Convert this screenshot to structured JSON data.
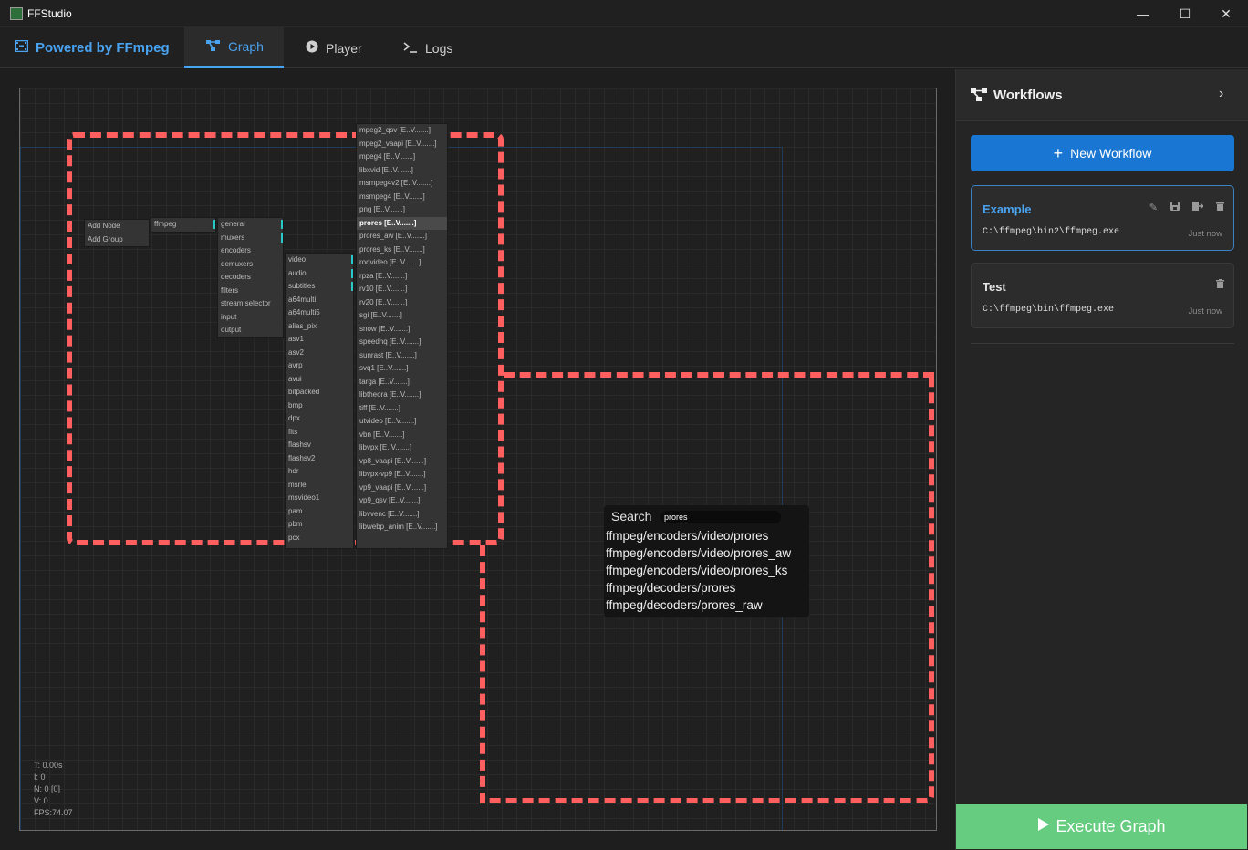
{
  "window": {
    "title": "FFStudio",
    "minimize": "—",
    "maximize": "☐",
    "close": "✕"
  },
  "nav": {
    "brand": "Powered by FFmpeg",
    "tabs": [
      {
        "label": "Graph",
        "icon": "graph-icon",
        "active": true
      },
      {
        "label": "Player",
        "icon": "play-icon",
        "active": false
      },
      {
        "label": "Logs",
        "icon": "terminal-icon",
        "active": false
      }
    ]
  },
  "graph": {
    "context_menu": [
      "Add Node",
      "Add Group"
    ],
    "ffmpeg_menu": [
      "ffmpeg"
    ],
    "category_menu": [
      "general",
      "muxers",
      "encoders",
      "demuxers",
      "decoders",
      "filters",
      "stream selector",
      "input",
      "output"
    ],
    "type_menu": [
      "video",
      "audio",
      "subtitles",
      "a64multi",
      "a64multi5",
      "alias_pix",
      "asv1",
      "asv2",
      "avrp",
      "avui",
      "bitpacked",
      "bmp",
      "dpx",
      "fits",
      "flashsv",
      "flashsv2",
      "hdr",
      "msrle",
      "msvideo1",
      "pam",
      "pbm",
      "pcx"
    ],
    "encoder_menu": [
      "mpeg2_qsv [E..V.......]",
      "mpeg2_vaapi [E..V.......]",
      "mpeg4 [E..V.......]",
      "libxvid [E..V.......]",
      "msmpeg4v2 [E..V.......]",
      "msmpeg4 [E..V.......]",
      "png [E..V.......]",
      "prores [E..V.......]",
      "prores_aw [E..V.......]",
      "prores_ks [E..V.......]",
      "roqvideo [E..V.......]",
      "rpza [E..V.......]",
      "rv10 [E..V.......]",
      "rv20 [E..V.......]",
      "sgi [E..V.......]",
      "snow [E..V.......]",
      "speedhq [E..V.......]",
      "sunrast [E..V.......]",
      "svq1 [E..V.......]",
      "targa [E..V.......]",
      "libtheora [E..V.......]",
      "tiff [E..V.......]",
      "utvideo [E..V.......]",
      "vbn [E..V.......]",
      "libvpx [E..V.......]",
      "vp8_vaapi [E..V.......]",
      "libvpx-vp9 [E..V.......]",
      "vp9_vaapi [E..V.......]",
      "vp9_qsv [E..V.......]",
      "libvvenc [E..V.......]",
      "libwebp_anim [E..V.......]"
    ],
    "search": {
      "label": "Search",
      "value": "prores",
      "results": [
        "ffmpeg/encoders/video/prores",
        "ffmpeg/encoders/video/prores_aw",
        "ffmpeg/encoders/video/prores_ks",
        "ffmpeg/decoders/prores",
        "ffmpeg/decoders/prores_raw"
      ]
    },
    "stats": [
      "T: 0.00s",
      "I: 0",
      "N: 0 [0]",
      "V: 0",
      "FPS:74.07"
    ]
  },
  "sidebar": {
    "title": "Workflows",
    "new_button": "New Workflow",
    "workflows": [
      {
        "name": "Example",
        "path": "C:\\ffmpeg\\bin2\\ffmpeg.exe",
        "time": "Just now",
        "selected": true
      },
      {
        "name": "Test",
        "path": "C:\\ffmpeg\\bin\\ffmpeg.exe",
        "time": "Just now",
        "selected": false
      }
    ]
  },
  "execute_button": "Execute Graph",
  "colors": {
    "accent": "#4aa3f0",
    "primary_button": "#1976d2",
    "execute_button": "#66cc80",
    "highlight_dash": "#ff5f5f",
    "socket": "#2cc7c7"
  }
}
